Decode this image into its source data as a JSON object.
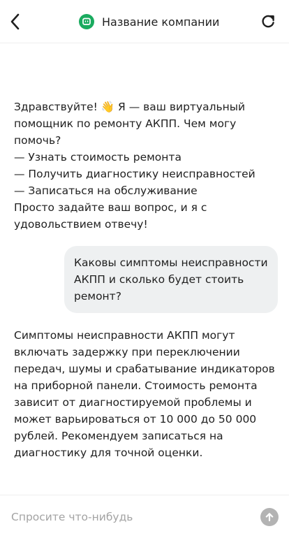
{
  "header": {
    "company_name": "Название компании",
    "back_icon": "chevron-left-icon",
    "refresh_icon": "refresh-icon",
    "logo_icon": "chat-bubble-logo-icon",
    "brand_color": "#1aab5f"
  },
  "messages": [
    {
      "role": "bot",
      "lines": [
        "Здравствуйте! 👋 Я — ваш виртуальный",
        "помощник по ремонту АКПП. Чем могу",
        "помочь?",
        "— Узнать стоимость ремонта",
        "— Получить диагностику неисправностей",
        "— Записаться на обслуживание",
        "Просто задайте ваш вопрос, и я с",
        "удовольствием отвечу!"
      ]
    },
    {
      "role": "user",
      "lines": [
        "Каковы симптомы неисправности",
        "АКПП и сколько будет стоить",
        "ремонт?"
      ]
    },
    {
      "role": "bot",
      "lines": [
        "Симптомы неисправности АКПП могут",
        "включать задержку при переключении",
        "передач, шумы и срабатывание индикаторов",
        "на приборной панели. Стоимость ремонта",
        "зависит от диагностируемой проблемы и",
        "может варьироваться от 10 000 до 50 000",
        "рублей. Рекомендуем записаться на",
        "диагностику для точной оценки."
      ]
    }
  ],
  "composer": {
    "placeholder": "Спросите что-нибудь",
    "value": "",
    "send_icon": "arrow-up-icon"
  }
}
